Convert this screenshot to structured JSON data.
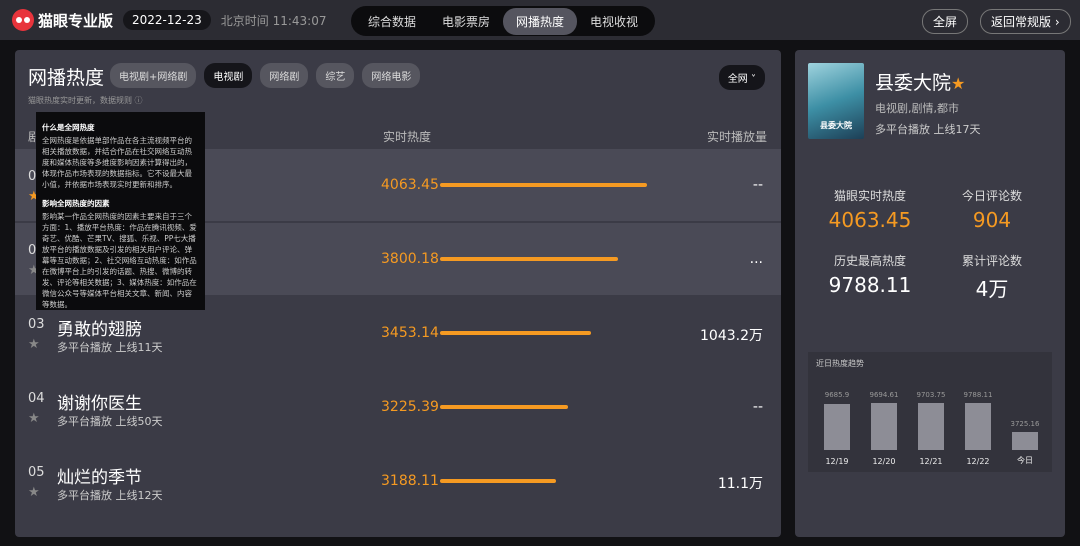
{
  "header": {
    "brand": "猫眼专业版",
    "date": "2022-12-23",
    "beijing_time": "北京时间 11:43:07",
    "nav": [
      "综合数据",
      "电影票房",
      "网播热度",
      "电视收视"
    ],
    "active_nav": 2,
    "fullscreen": "全屏",
    "back": "返回常规版 ›"
  },
  "main": {
    "title": "网播热度",
    "chips": [
      "电视剧+网络剧",
      "电视剧",
      "网络剧",
      "综艺",
      "网络电影"
    ],
    "active_chip": 1,
    "platform": "全网 ˅",
    "note": "猫眼热度实时更新，数据规则 ⓘ",
    "columns": {
      "rank": "剧",
      "heat": "实时热度",
      "play": "实时播放量"
    },
    "rows": [
      {
        "rank": "01",
        "name": "",
        "sub": "",
        "heat": "4063.45",
        "fill": 1.0,
        "play": "--",
        "starred": true
      },
      {
        "rank": "02",
        "name": "",
        "sub": "",
        "heat": "3800.18",
        "fill": 0.86,
        "play": "...",
        "starred": false
      },
      {
        "rank": "03",
        "name": "勇敢的翅膀",
        "sub": "多平台播放  上线11天",
        "heat": "3453.14",
        "fill": 0.73,
        "play": "1043.2万",
        "starred": false
      },
      {
        "rank": "04",
        "name": "谢谢你医生",
        "sub": "多平台播放  上线50天",
        "heat": "3225.39",
        "fill": 0.62,
        "play": "--",
        "starred": false
      },
      {
        "rank": "05",
        "name": "灿烂的季节",
        "sub": "多平台播放  上线12天",
        "heat": "3188.11",
        "fill": 0.56,
        "play": "11.1万",
        "starred": false
      }
    ]
  },
  "tooltip": {
    "h1": "什么是全网热度",
    "p1": "全网热度是依据单部作品在各主流视频平台的相关播放数据，并结合作品在社交网络互动热度和媒体热度等多维度影响因素计算得出的，体现作品市场表现的数据指标。它不设最大最小值，并依据市场表现实时更新和排序。",
    "h2": "影响全网热度的因素",
    "p2": "影响某一作品全网热度的因素主要来自于三个方面：1、播放平台热度：作品在腾讯视频、爱奇艺、优酷、芒果TV、搜狐、乐视、PP七大播放平台的播放数据及引发的相关用户评论、弹幕等互动数据；2、社交网络互动热度：如作品在微博平台上的引发的话题、热搜、微博的转发、评论等相关数据；3、媒体热度：如作品在微信公众号等媒体平台相关文章、新闻、内容等数据。"
  },
  "detail": {
    "poster_text": "县委大院",
    "title": "县委大院",
    "genre": "电视剧,剧情,都市",
    "platform": "多平台播放  上线17天",
    "stats": [
      {
        "label": "猫眼实时热度",
        "value": "4063.45"
      },
      {
        "label": "今日评论数",
        "value": "904"
      },
      {
        "label": "历史最高热度",
        "value": "9788.11"
      },
      {
        "label": "累计评论数",
        "value": "4万"
      }
    ],
    "trend": {
      "title": "近日热度趋势",
      "bars": [
        {
          "label": "12/19",
          "value": 9685.9,
          "text": "9685.9"
        },
        {
          "label": "12/20",
          "value": 9694.61,
          "text": "9694.61"
        },
        {
          "label": "12/21",
          "value": 9703.75,
          "text": "9703.75"
        },
        {
          "label": "12/22",
          "value": 9788.11,
          "text": "9788.11"
        },
        {
          "label": "今日",
          "value": 3725.16,
          "text": "3725.16"
        }
      ]
    }
  },
  "colors": {
    "accent": "#f59a22",
    "brand": "#e8343c"
  }
}
